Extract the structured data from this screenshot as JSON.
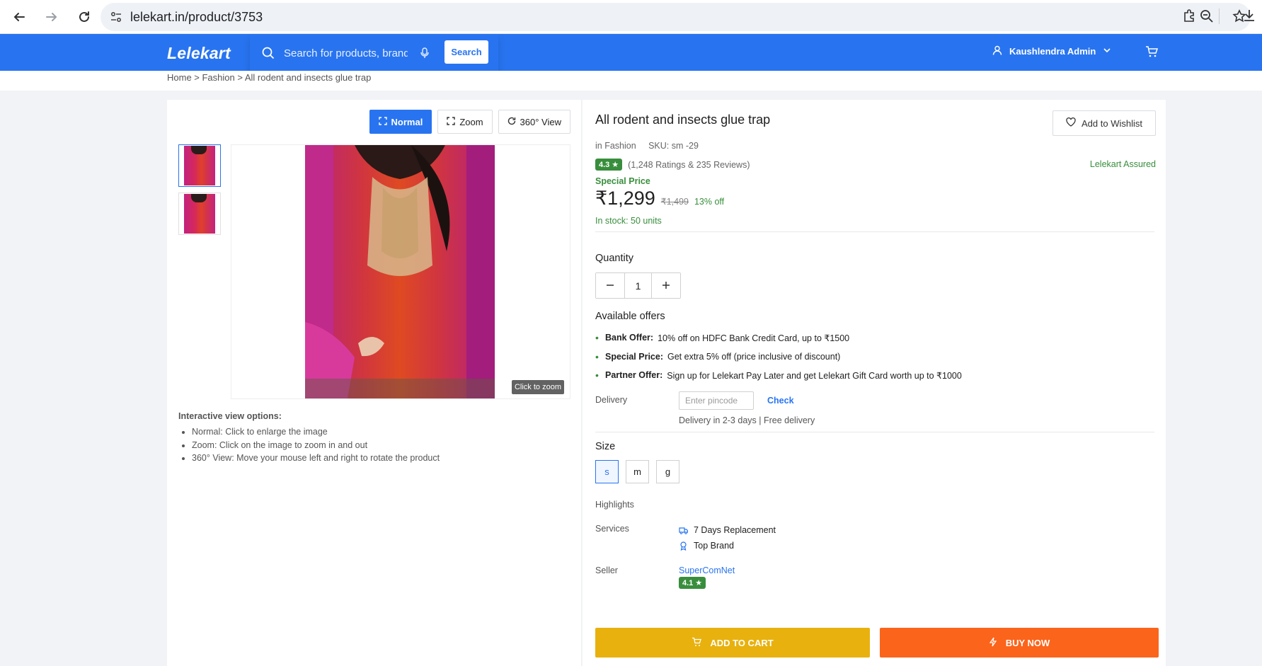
{
  "browser": {
    "url": "lelekart.in/product/3753"
  },
  "header": {
    "logo": "Lelekart",
    "search_placeholder": "Search for products, brands and more",
    "search_button": "Search",
    "user_name": "Kaushlendra Admin"
  },
  "breadcrumb": "Home > Fashion > All rodent and insects glue trap",
  "gallery": {
    "view_buttons": [
      "Normal",
      "Zoom",
      "360° View"
    ],
    "active_view": "Normal",
    "zoom_hint": "Click to zoom",
    "notes_title": "Interactive view options:",
    "notes": [
      "Normal: Click to enlarge the image",
      "Zoom: Click on the image to zoom in and out",
      "360° View: Move your mouse left and right to rotate the product"
    ]
  },
  "product": {
    "title": "All rodent and insects glue trap",
    "wishlist_label": "Add to Wishlist",
    "category": "in Fashion",
    "sku": "SKU: sm -29",
    "rating": "4.3",
    "rating_text": "(1,248 Ratings & 235 Reviews)",
    "assured": "Lelekart Assured",
    "special_label": "Special Price",
    "price": "₹1,299",
    "mrp": "₹1,499",
    "discount": "13% off",
    "stock": "In stock: 50 units",
    "quantity_label": "Quantity",
    "quantity": "1",
    "offers_title": "Available offers",
    "offers": [
      {
        "title": "Bank Offer:",
        "text": "10% off on HDFC Bank Credit Card, up to ₹1500"
      },
      {
        "title": "Special Price:",
        "text": "Get extra 5% off (price inclusive of discount)"
      },
      {
        "title": "Partner Offer:",
        "text": "Sign up for Lelekart Pay Later and get Lelekart Gift Card worth up to ₹1000"
      }
    ],
    "delivery_label": "Delivery",
    "pincode_placeholder": "Enter pincode",
    "check_label": "Check",
    "delivery_info": "Delivery in 2-3 days | Free delivery",
    "size_label": "Size",
    "sizes": [
      "s",
      "m",
      "g"
    ],
    "selected_size": "s",
    "highlights_label": "Highlights",
    "services_label": "Services",
    "services": [
      "7 Days Replacement",
      "Top Brand"
    ],
    "seller_label": "Seller",
    "seller_name": "SuperComNet",
    "seller_rating": "4.1",
    "add_to_cart": "ADD TO CART",
    "buy_now": "BUY NOW"
  },
  "colors": {
    "brand_blue": "#2874f0",
    "green": "#388e3c",
    "cart_yellow": "#e8b10e",
    "buy_orange": "#fb641b"
  }
}
